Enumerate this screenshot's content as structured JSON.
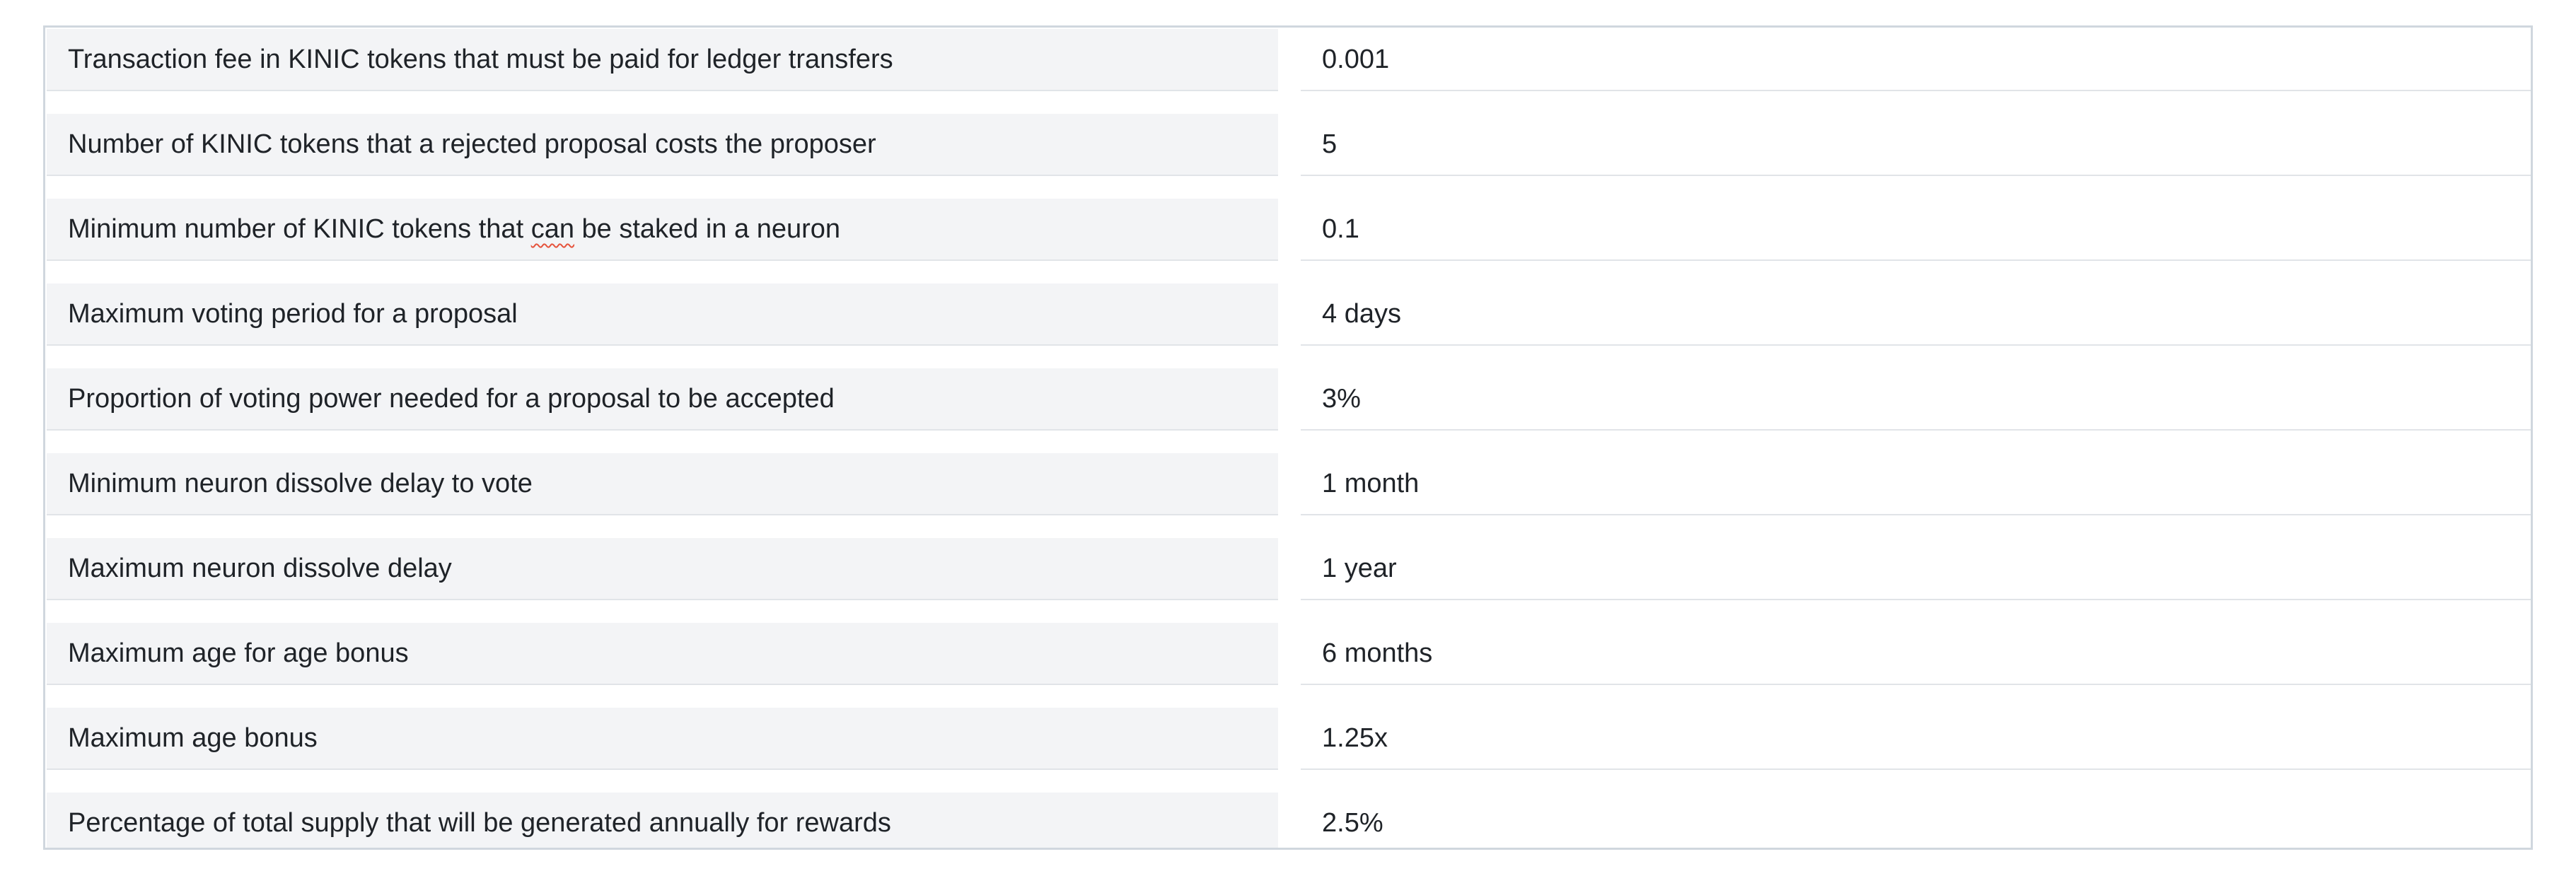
{
  "table": {
    "rows": [
      {
        "label": "Transaction fee in KINIC tokens that must be paid for ledger transfers",
        "value": "0.001"
      },
      {
        "label": "Number of KINIC tokens that a rejected proposal costs the proposer",
        "value": "5"
      },
      {
        "label_before": "Minimum number of KINIC tokens that ",
        "label_flagged_word": "can",
        "label_after": " be staked in a neuron",
        "value": "0.1"
      },
      {
        "label": "Maximum voting period for a proposal",
        "value": "4 days"
      },
      {
        "label": "Proportion of voting power needed for a proposal to be accepted",
        "value": "3%"
      },
      {
        "label": "Minimum neuron dissolve delay to vote",
        "value": "1 month"
      },
      {
        "label": "Maximum neuron dissolve delay",
        "value": "1 year"
      },
      {
        "label": "Maximum age for age bonus",
        "value": "6 months"
      },
      {
        "label": "Maximum age bonus",
        "value": "1.25x"
      },
      {
        "label": "Percentage of total supply that will be generated annually for rewards",
        "value": "2.5%"
      }
    ]
  }
}
